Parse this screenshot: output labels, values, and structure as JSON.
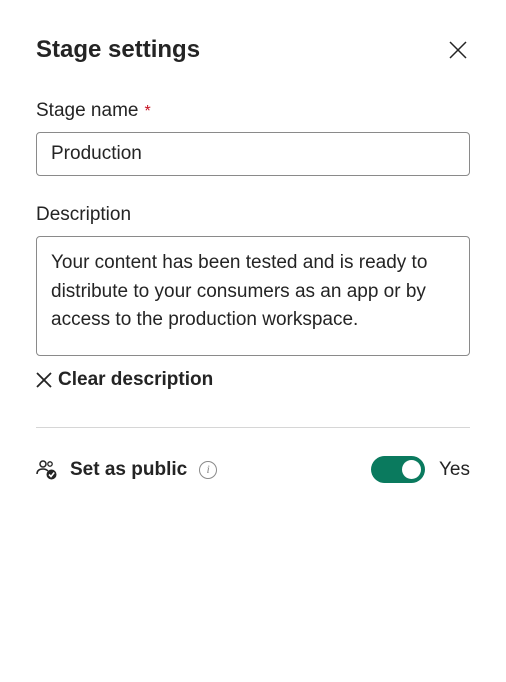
{
  "header": {
    "title": "Stage settings"
  },
  "fields": {
    "stageName": {
      "label": "Stage name",
      "required_marker": "*",
      "value": "Production"
    },
    "description": {
      "label": "Description",
      "value": "Your content has been tested and is ready to distribute to your consumers as an app or by access to the production workspace.",
      "clear_label": "Clear description"
    }
  },
  "public": {
    "label": "Set as public",
    "toggle_state": "on",
    "toggle_text": "Yes"
  },
  "colors": {
    "toggle_on": "#0a7a5e",
    "required": "#c50f1f"
  }
}
